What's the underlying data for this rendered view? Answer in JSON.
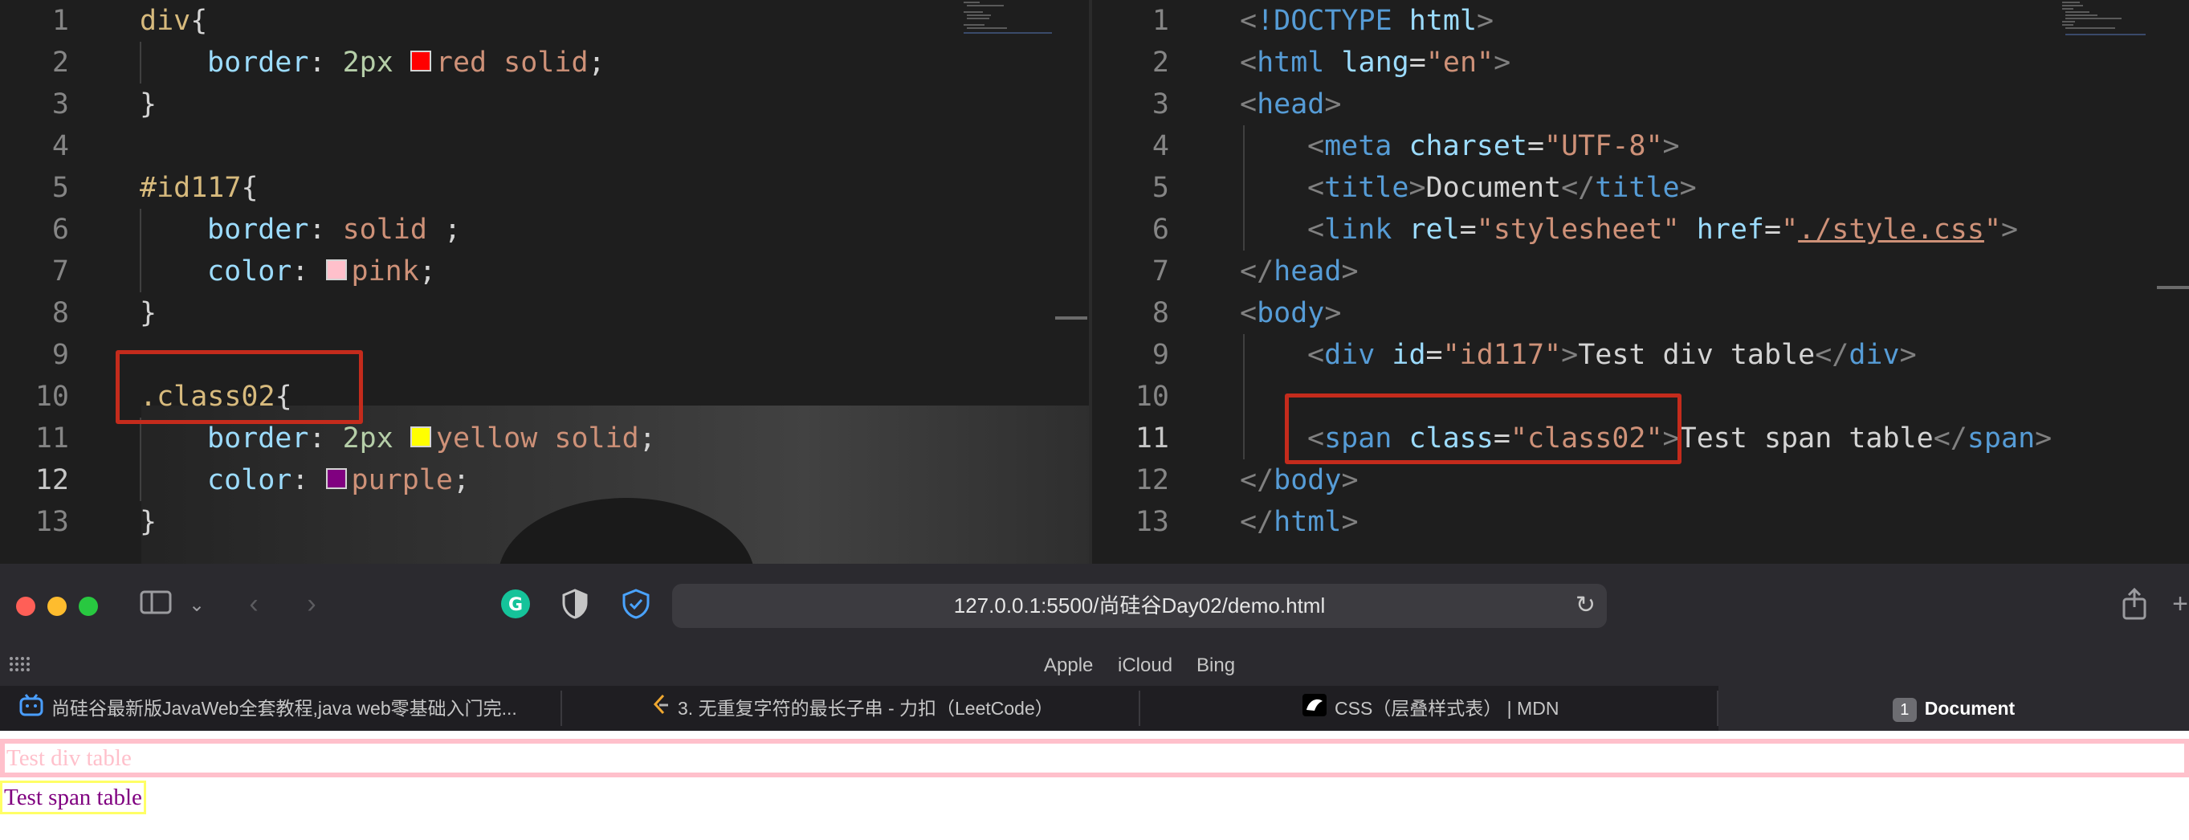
{
  "left_editor": {
    "active_line": 12,
    "lines": [
      {
        "n": "1",
        "tokens": [
          {
            "t": "div",
            "c": "sel"
          },
          {
            "t": "{",
            "c": "pun"
          }
        ]
      },
      {
        "n": "2",
        "indent": 1,
        "tokens": [
          {
            "t": "border",
            "c": "prop"
          },
          {
            "t": ": ",
            "c": "pun"
          },
          {
            "t": "2px ",
            "c": "num"
          },
          {
            "swatch": "#ff0000"
          },
          {
            "t": "red solid",
            "c": "val"
          },
          {
            "t": ";",
            "c": "pun"
          }
        ]
      },
      {
        "n": "3",
        "tokens": [
          {
            "t": "}",
            "c": "pun"
          }
        ]
      },
      {
        "n": "4",
        "tokens": []
      },
      {
        "n": "5",
        "tokens": [
          {
            "t": "#id117",
            "c": "sel"
          },
          {
            "t": "{",
            "c": "pun"
          }
        ]
      },
      {
        "n": "6",
        "indent": 1,
        "tokens": [
          {
            "t": "border",
            "c": "prop"
          },
          {
            "t": ": ",
            "c": "pun"
          },
          {
            "t": "solid",
            "c": "val"
          },
          {
            "t": " ;",
            "c": "pun"
          }
        ]
      },
      {
        "n": "7",
        "indent": 1,
        "tokens": [
          {
            "t": "color",
            "c": "prop"
          },
          {
            "t": ": ",
            "c": "pun"
          },
          {
            "swatch": "#ffc0cb"
          },
          {
            "t": "pink",
            "c": "val"
          },
          {
            "t": ";",
            "c": "pun"
          }
        ]
      },
      {
        "n": "8",
        "tokens": [
          {
            "t": "}",
            "c": "pun"
          }
        ]
      },
      {
        "n": "9",
        "tokens": []
      },
      {
        "n": "10",
        "tokens": [
          {
            "t": ".class02",
            "c": "sel"
          },
          {
            "t": "{",
            "c": "pun"
          }
        ]
      },
      {
        "n": "11",
        "indent": 1,
        "tokens": [
          {
            "t": "border",
            "c": "prop"
          },
          {
            "t": ": ",
            "c": "pun"
          },
          {
            "t": "2px ",
            "c": "num"
          },
          {
            "swatch": "#ffff00"
          },
          {
            "t": "yellow solid",
            "c": "val"
          },
          {
            "t": ";",
            "c": "pun"
          }
        ]
      },
      {
        "n": "12",
        "indent": 1,
        "tokens": [
          {
            "t": "color",
            "c": "prop"
          },
          {
            "t": ": ",
            "c": "pun"
          },
          {
            "swatch": "#800080"
          },
          {
            "t": "purple",
            "c": "val"
          },
          {
            "t": ";",
            "c": "pun"
          }
        ]
      },
      {
        "n": "13",
        "tokens": [
          {
            "t": "}",
            "c": "pun"
          }
        ]
      }
    ]
  },
  "right_editor": {
    "active_line": 11,
    "lines": [
      {
        "n": "1",
        "tokens": [
          {
            "t": "<",
            "c": "brk"
          },
          {
            "t": "!DOCTYPE ",
            "c": "tag"
          },
          {
            "t": "html",
            "c": "attr"
          },
          {
            "t": ">",
            "c": "brk"
          }
        ]
      },
      {
        "n": "2",
        "tokens": [
          {
            "t": "<",
            "c": "brk"
          },
          {
            "t": "html",
            "c": "tag"
          },
          {
            "t": " lang",
            "c": "attr"
          },
          {
            "t": "=",
            "c": "pun"
          },
          {
            "t": "\"en\"",
            "c": "str"
          },
          {
            "t": ">",
            "c": "brk"
          }
        ]
      },
      {
        "n": "3",
        "tokens": [
          {
            "t": "<",
            "c": "brk"
          },
          {
            "t": "head",
            "c": "tag"
          },
          {
            "t": ">",
            "c": "brk"
          }
        ]
      },
      {
        "n": "4",
        "indent": 1,
        "tokens": [
          {
            "t": "<",
            "c": "brk"
          },
          {
            "t": "meta",
            "c": "tag"
          },
          {
            "t": " charset",
            "c": "attr"
          },
          {
            "t": "=",
            "c": "pun"
          },
          {
            "t": "\"UTF-8\"",
            "c": "str"
          },
          {
            "t": ">",
            "c": "brk"
          }
        ]
      },
      {
        "n": "5",
        "indent": 1,
        "tokens": [
          {
            "t": "<",
            "c": "brk"
          },
          {
            "t": "title",
            "c": "tag"
          },
          {
            "t": ">",
            "c": "brk"
          },
          {
            "t": "Document",
            "c": "text"
          },
          {
            "t": "</",
            "c": "brk"
          },
          {
            "t": "title",
            "c": "tag"
          },
          {
            "t": ">",
            "c": "brk"
          }
        ]
      },
      {
        "n": "6",
        "indent": 1,
        "tokens": [
          {
            "t": "<",
            "c": "brk"
          },
          {
            "t": "link",
            "c": "tag"
          },
          {
            "t": " rel",
            "c": "attr"
          },
          {
            "t": "=",
            "c": "pun"
          },
          {
            "t": "\"stylesheet\"",
            "c": "str"
          },
          {
            "t": " href",
            "c": "attr"
          },
          {
            "t": "=",
            "c": "pun"
          },
          {
            "t": "\"",
            "c": "str"
          },
          {
            "t": "./style.css",
            "c": "str",
            "u": true
          },
          {
            "t": "\"",
            "c": "str"
          },
          {
            "t": ">",
            "c": "brk"
          }
        ]
      },
      {
        "n": "7",
        "tokens": [
          {
            "t": "</",
            "c": "brk"
          },
          {
            "t": "head",
            "c": "tag"
          },
          {
            "t": ">",
            "c": "brk"
          }
        ]
      },
      {
        "n": "8",
        "tokens": [
          {
            "t": "<",
            "c": "brk"
          },
          {
            "t": "body",
            "c": "tag"
          },
          {
            "t": ">",
            "c": "brk"
          }
        ]
      },
      {
        "n": "9",
        "indent": 1,
        "tokens": [
          {
            "t": "<",
            "c": "brk"
          },
          {
            "t": "div",
            "c": "tag"
          },
          {
            "t": " id",
            "c": "attr"
          },
          {
            "t": "=",
            "c": "pun"
          },
          {
            "t": "\"id117\"",
            "c": "str"
          },
          {
            "t": ">",
            "c": "brk"
          },
          {
            "t": "Test div table",
            "c": "text"
          },
          {
            "t": "</",
            "c": "brk"
          },
          {
            "t": "div",
            "c": "tag"
          },
          {
            "t": ">",
            "c": "brk"
          }
        ]
      },
      {
        "n": "10",
        "tokens": []
      },
      {
        "n": "11",
        "indent": 1,
        "tokens": [
          {
            "t": "<",
            "c": "brk"
          },
          {
            "t": "span",
            "c": "tag"
          },
          {
            "t": " class",
            "c": "attr"
          },
          {
            "t": "=",
            "c": "pun"
          },
          {
            "t": "\"class02\"",
            "c": "str"
          },
          {
            "t": ">",
            "c": "brk"
          },
          {
            "t": "Test span table",
            "c": "text"
          },
          {
            "t": "</",
            "c": "brk"
          },
          {
            "t": "span",
            "c": "tag"
          },
          {
            "t": ">",
            "c": "brk"
          }
        ]
      },
      {
        "n": "12",
        "tokens": [
          {
            "t": "</",
            "c": "brk"
          },
          {
            "t": "body",
            "c": "tag"
          },
          {
            "t": ">",
            "c": "brk"
          }
        ]
      },
      {
        "n": "13",
        "tokens": [
          {
            "t": "</",
            "c": "brk"
          },
          {
            "t": "html",
            "c": "tag"
          },
          {
            "t": ">",
            "c": "brk"
          }
        ]
      }
    ]
  },
  "browser": {
    "url": "127.0.0.1:5500/尚硅谷Day02/demo.html",
    "favorites": [
      "Apple",
      "iCloud",
      "Bing"
    ],
    "tabs": [
      {
        "label": "尚硅谷最新版JavaWeb全套教程,java web零基础入门完...",
        "icon": "bilibili-icon"
      },
      {
        "label": "3. 无重复字符的最长子串 - 力扣（LeetCode）",
        "icon": "leetcode-icon"
      },
      {
        "label": "CSS（层叠样式表） | MDN",
        "icon": "mdn-icon"
      },
      {
        "label": "Document",
        "badge": "1",
        "active": true
      }
    ],
    "traffic_light_colors": {
      "close": "#ff5f57",
      "minimize": "#febc2e",
      "zoom": "#28c840"
    }
  },
  "page": {
    "div_text": "Test div table",
    "span_text": "Test span table",
    "div_color": "#ffc0cb",
    "div_border_color": "#ffc0cb",
    "span_color": "#800080",
    "span_border_color": "#ffff66"
  },
  "highlight_color": "#c42b1c"
}
